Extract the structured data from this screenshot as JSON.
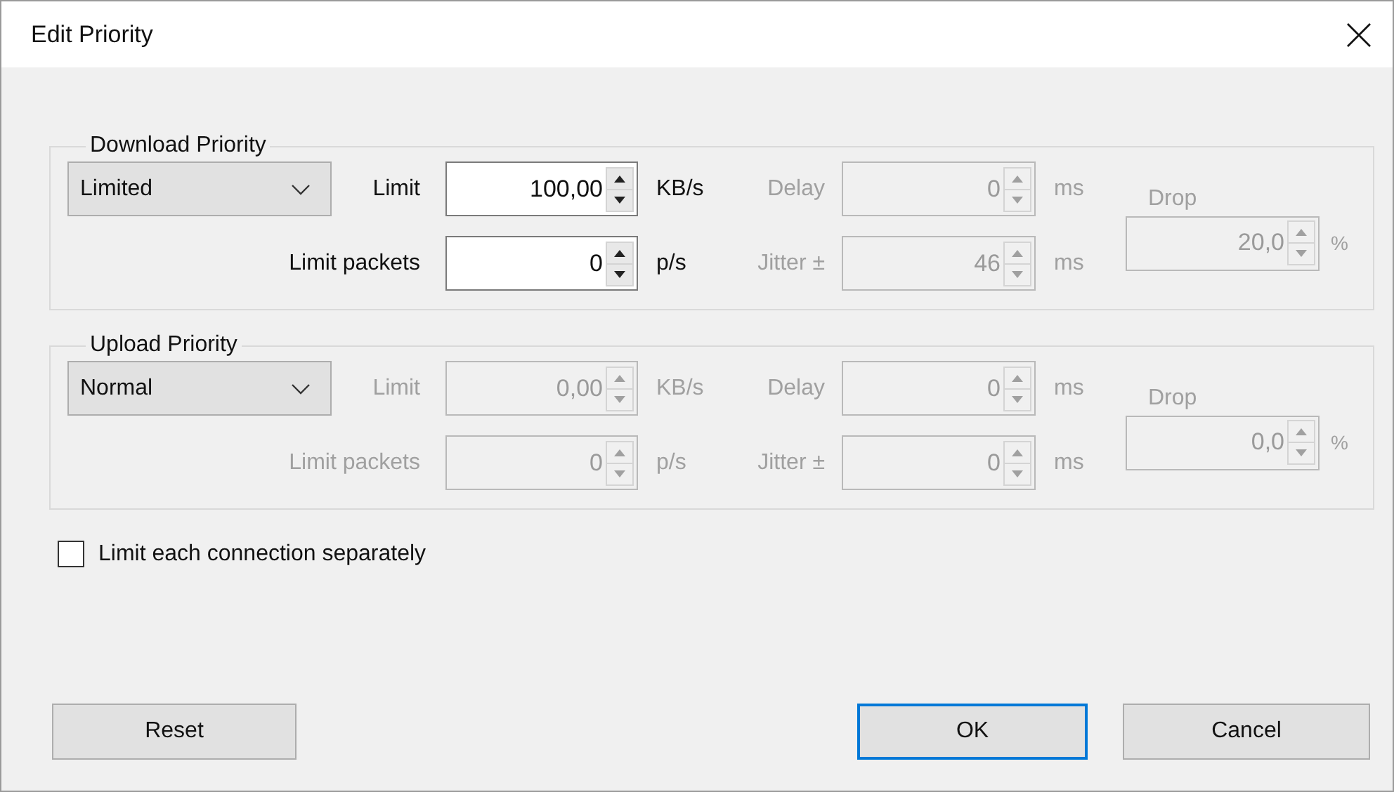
{
  "window": {
    "title": "Edit Priority"
  },
  "groups": [
    {
      "title": "Download Priority",
      "mode": "Limited",
      "fields": [
        {
          "label": "Limit",
          "value": "100,00",
          "unit": "KB/s",
          "disabled": false
        },
        {
          "label": "Delay",
          "value": "0",
          "unit": "ms",
          "disabled": true
        },
        {
          "label": "Drop",
          "value": "20,0",
          "unit": "%",
          "disabled": true
        },
        {
          "label": "Limit packets",
          "value": "0",
          "unit": "p/s",
          "disabled": false
        },
        {
          "label": "Jitter ±",
          "value": "46",
          "unit": "ms",
          "disabled": true
        }
      ]
    },
    {
      "title": "Upload Priority",
      "mode": "Normal",
      "fields": [
        {
          "label": "Limit",
          "value": "0,00",
          "unit": "KB/s",
          "disabled": true
        },
        {
          "label": "Delay",
          "value": "0",
          "unit": "ms",
          "disabled": true
        },
        {
          "label": "Drop",
          "value": "0,0",
          "unit": "%",
          "disabled": true
        },
        {
          "label": "Limit packets",
          "value": "0",
          "unit": "p/s",
          "disabled": true
        },
        {
          "label": "Jitter ±",
          "value": "0",
          "unit": "ms",
          "disabled": true
        }
      ]
    }
  ],
  "checkbox": {
    "label": "Limit each connection separately",
    "checked": false
  },
  "buttons": [
    {
      "label": "Reset",
      "default": false
    },
    {
      "label": "OK",
      "default": true
    },
    {
      "label": "Cancel",
      "default": false
    }
  ]
}
